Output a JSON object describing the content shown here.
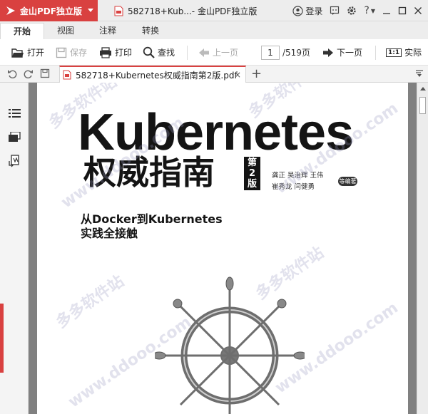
{
  "app": {
    "name": "金山PDF独立版",
    "window_title": "582718+Kub...- 金山PDF独立版",
    "login_label": "登录",
    "brand_color": "#d94140"
  },
  "menu": {
    "tabs": [
      "开始",
      "视图",
      "注释",
      "转换"
    ],
    "active": "开始"
  },
  "toolbar": {
    "open": "打开",
    "save": "保存",
    "print": "打印",
    "find": "查找",
    "prev_page": "上一页",
    "current_page": "1",
    "page_total": "/519页",
    "next_page": "下一页",
    "actual_size_icon_text": "1:1",
    "actual_size": "实际"
  },
  "document_tab": {
    "filename": "582718+Kubernetes权威指南第2版.pdf",
    "close": "×",
    "add": "+"
  },
  "page": {
    "title": "Kubernetes",
    "subtitle": "权威指南",
    "edition": "第2版",
    "authors_line1": "龚正  吴治辉  王伟",
    "authors_line2": "崔秀龙  闫健勇",
    "authors_badge": "等编著",
    "tagline_line1": "从Docker到Kubernetes",
    "tagline_line2": "实践全接触"
  },
  "watermarks": [
    "多多软件站",
    "www.ddooo.com"
  ]
}
